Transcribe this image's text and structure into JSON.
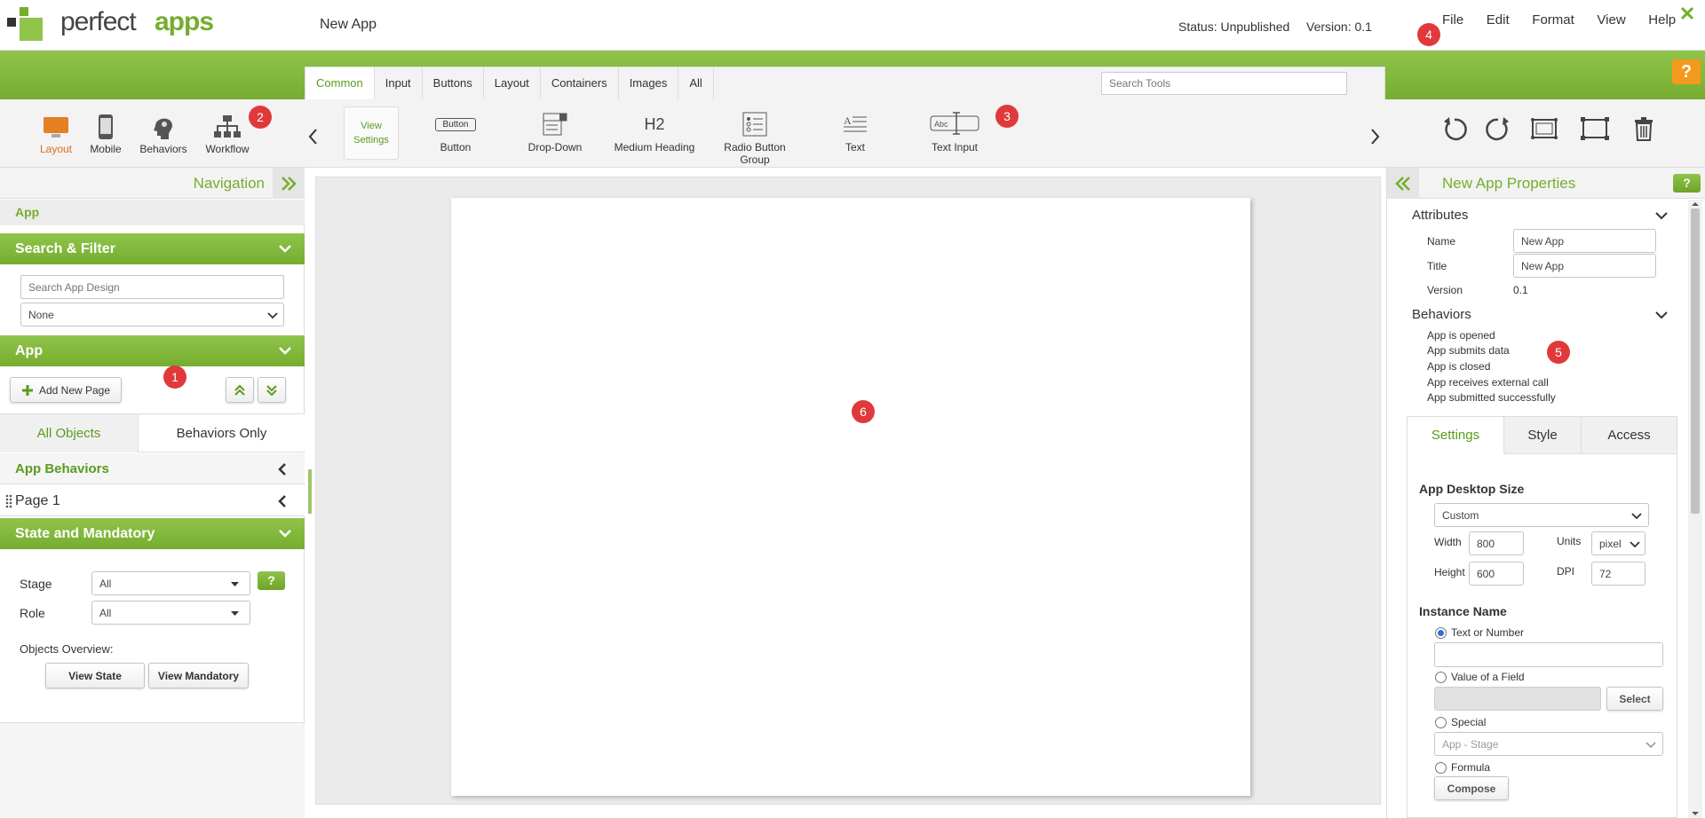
{
  "header": {
    "logo_text_1": "perfect",
    "logo_text_2": "apps",
    "app_name": "New App",
    "status_label": "Status:",
    "status_value": "Unpublished",
    "version_label": "Version:",
    "version_value": "0.1",
    "menu": [
      "File",
      "Edit",
      "Format",
      "View",
      "Help"
    ],
    "close_icon": "close-icon",
    "help_label": "?"
  },
  "badges": [
    "1",
    "2",
    "3",
    "4",
    "5",
    "6"
  ],
  "toolbox": {
    "tabs": [
      "Common",
      "Input",
      "Buttons",
      "Layout",
      "Containers",
      "Images",
      "All"
    ],
    "active_tab": "Common",
    "search_placeholder": "Search Tools",
    "tools": [
      {
        "label_1": "View",
        "label_2": "Settings"
      },
      {
        "label": "Button",
        "icon_text": "Button"
      },
      {
        "label": "Drop-Down"
      },
      {
        "label": "Medium Heading",
        "icon_text": "H2"
      },
      {
        "label": "Radio Button Group"
      },
      {
        "label": "Text"
      },
      {
        "label": "Text Input",
        "icon_text": "Abc"
      }
    ]
  },
  "modes": [
    "Layout",
    "Mobile",
    "Behaviors",
    "Workflow"
  ],
  "navigation": {
    "title": "Navigation",
    "app_label": "App",
    "search_filter_title": "Search & Filter",
    "search_placeholder": "Search App Design",
    "filter_value": "None",
    "app_section_title": "App",
    "add_page_label": "Add New Page",
    "tab_all": "All Objects",
    "tab_behaviors": "Behaviors Only",
    "app_behaviors": "App Behaviors",
    "page_1": "Page 1",
    "state_title": "State and Mandatory",
    "stage_label": "Stage",
    "stage_value": "All",
    "role_label": "Role",
    "role_value": "All",
    "help_label": "?",
    "objects_overview": "Objects Overview:",
    "view_state": "View State",
    "view_mandatory": "View Mandatory"
  },
  "properties": {
    "title": "New App Properties",
    "help_label": "?",
    "attributes_title": "Attributes",
    "name_label": "Name",
    "name_value": "New App",
    "title_label": "Title",
    "title_value": "New App",
    "version_label": "Version",
    "version_value": "0.1",
    "behaviors_title": "Behaviors",
    "behaviors": [
      "App is opened",
      "App submits data",
      "App is closed",
      "App receives external call",
      "App submitted successfully"
    ],
    "tabs": [
      "Settings",
      "Style",
      "Access"
    ],
    "active_tab": "Settings",
    "desktop_size_title": "App Desktop Size",
    "desktop_size_value": "Custom",
    "width_label": "Width",
    "width_value": "800",
    "units_label": "Units",
    "units_value": "pixel",
    "height_label": "Height",
    "height_value": "600",
    "dpi_label": "DPI",
    "dpi_value": "72",
    "instance_title": "Instance Name",
    "opt_text": "Text or Number",
    "opt_field": "Value of a Field",
    "select_label": "Select",
    "opt_special": "Special",
    "special_value": "App - Stage",
    "opt_formula": "Formula",
    "compose_label": "Compose"
  },
  "colors": {
    "brand_green": "#76ad2f",
    "accent_orange": "#f39a1e",
    "badge_red": "#e0393b"
  }
}
